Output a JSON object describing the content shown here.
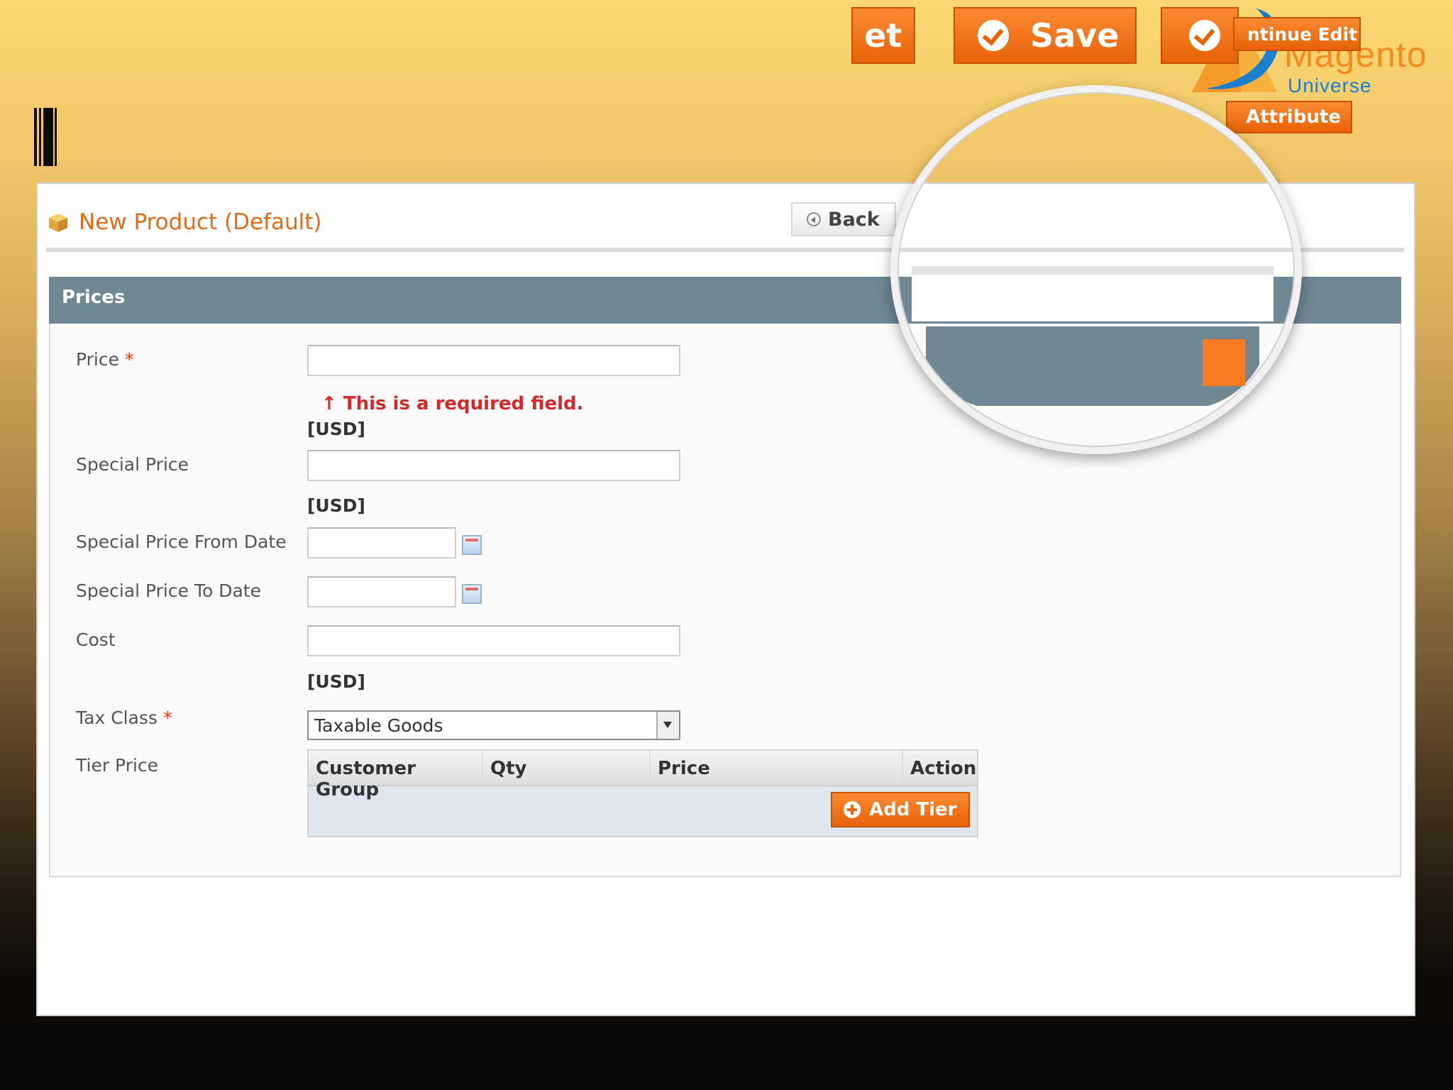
{
  "brand": {
    "name": "Magento",
    "subtitle": "Universe",
    "colors": {
      "orange": "#f58a1f",
      "blue": "#1b7fd0"
    }
  },
  "header": {
    "title": "New Product (Default)",
    "icon": "package-icon",
    "buttons": {
      "back": "Back",
      "reset_fragment": "et",
      "save": "Save",
      "save_continue_fragment": "ntinue Edit"
    }
  },
  "section": {
    "title": "Prices",
    "attribute_button_fragment": "Attribute"
  },
  "form": {
    "price": {
      "label": "Price",
      "required": "*",
      "value": "",
      "error": "This is a required field.",
      "currency": "[USD]"
    },
    "special_price": {
      "label": "Special Price",
      "value": "",
      "currency": "[USD]"
    },
    "special_from": {
      "label": "Special Price From Date",
      "value": ""
    },
    "special_to": {
      "label": "Special Price To Date",
      "value": ""
    },
    "cost": {
      "label": "Cost",
      "value": "",
      "currency": "[USD]"
    },
    "tax_class": {
      "label": "Tax Class",
      "required": "*",
      "selected": "Taxable Goods"
    },
    "tier_price": {
      "label": "Tier Price",
      "columns": [
        "Customer Group",
        "Qty",
        "Price",
        "Action"
      ],
      "add_button": "Add Tier"
    }
  },
  "colors": {
    "accent_orange": "#e86208",
    "section_header": "#6f8894",
    "error_red": "#d12a2a",
    "required_red": "#eb340a"
  }
}
